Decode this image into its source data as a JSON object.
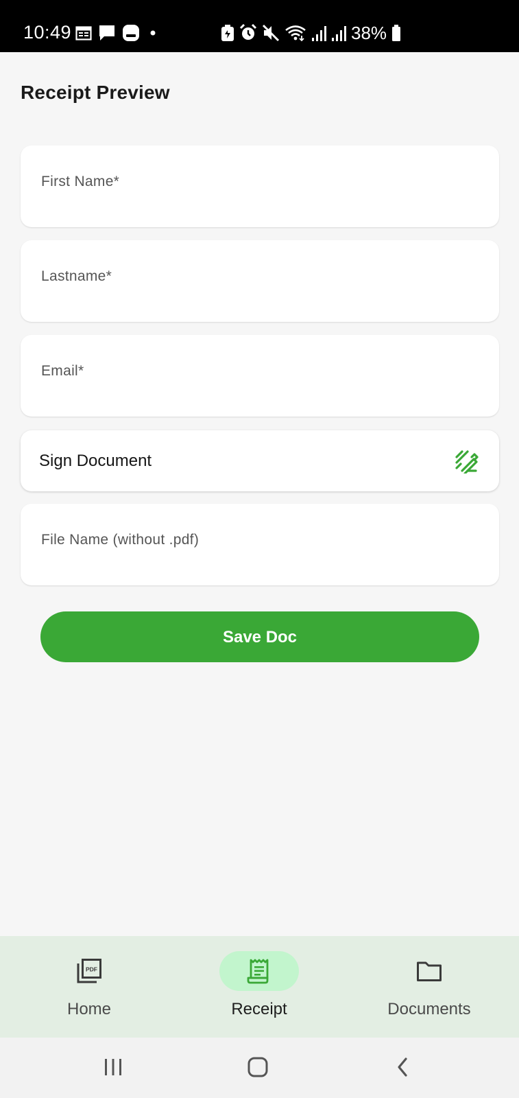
{
  "status_bar": {
    "time": "10:49",
    "battery": "38%",
    "left_icons": [
      "calendar-icon",
      "chat-icon",
      "app-notification-icon",
      "dot-icon"
    ],
    "right_icons": [
      "battery-saver-icon",
      "alarm-icon",
      "mute-icon",
      "wifi-icon",
      "signal-icon",
      "signal-icon-2",
      "battery-icon"
    ]
  },
  "page": {
    "title": "Receipt Preview"
  },
  "form": {
    "first_name_placeholder": "First Name*",
    "last_name_placeholder": "Lastname*",
    "email_placeholder": "Email*",
    "sign_label": "Sign Document",
    "sign_icon": "signature-pen-icon",
    "file_name_placeholder": "File Name (without .pdf)",
    "save_label": "Save Doc"
  },
  "bottom_nav": {
    "items": [
      {
        "label": "Home",
        "icon": "pdf-stack-icon",
        "active": false
      },
      {
        "label": "Receipt",
        "icon": "receipt-icon",
        "active": true
      },
      {
        "label": "Documents",
        "icon": "folder-icon",
        "active": false
      }
    ]
  },
  "system_nav": {
    "buttons": [
      "recents-icon",
      "home-icon",
      "back-icon"
    ]
  },
  "colors": {
    "accent": "#3aa836",
    "active_pill": "#c2f5cd",
    "nav_background": "#e3eee3",
    "page_background": "#f6f6f6",
    "status_bar": "#000000"
  }
}
